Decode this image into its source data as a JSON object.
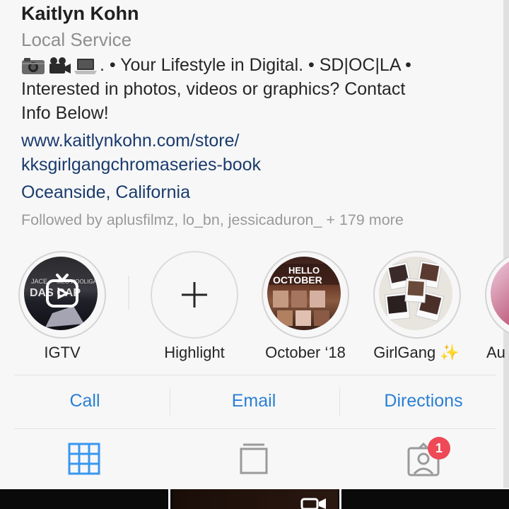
{
  "profile": {
    "name": "Kaitlyn Kohn",
    "category": "Local Service",
    "bio_line1": ". • Your Lifestyle in Digital. • SD|OC|LA •",
    "bio_line2": "Interested in photos, videos or graphics? Contact",
    "bio_line3": "Info Below!",
    "bio_emojis": [
      "camera-icon",
      "video-camera-icon",
      "laptop-icon"
    ],
    "link_line1": "www.kaitlynkohn.com/store/",
    "link_line2": "kksgirlgangchromaseries-book",
    "location": "Oceanside, California",
    "followed_by": "Followed by aplusfilmz, lo_bn, jessicaduron_ + 179 more"
  },
  "highlights": [
    {
      "label": "IGTV",
      "icon": "igtv-icon",
      "cover_text": "JACE  MEG  HOOLIGAN  DAS CAP"
    },
    {
      "label": "Highlight",
      "icon": "plus-icon"
    },
    {
      "label": "October ‘18",
      "cover_text": "HELLO OCTOBER"
    },
    {
      "label": "GirlGang ✨"
    },
    {
      "label": "Au"
    }
  ],
  "actions": {
    "call": "Call",
    "email": "Email",
    "directions": "Directions"
  },
  "tabs": {
    "grid_icon": "grid-icon",
    "igtv_icon": "tv-icon",
    "tagged_icon": "tagged-icon",
    "tagged_badge": "1"
  },
  "colors": {
    "link": "#1a3b6e",
    "action": "#2a7fd4",
    "active_tab": "#3897f0",
    "badge": "#ed4956"
  }
}
